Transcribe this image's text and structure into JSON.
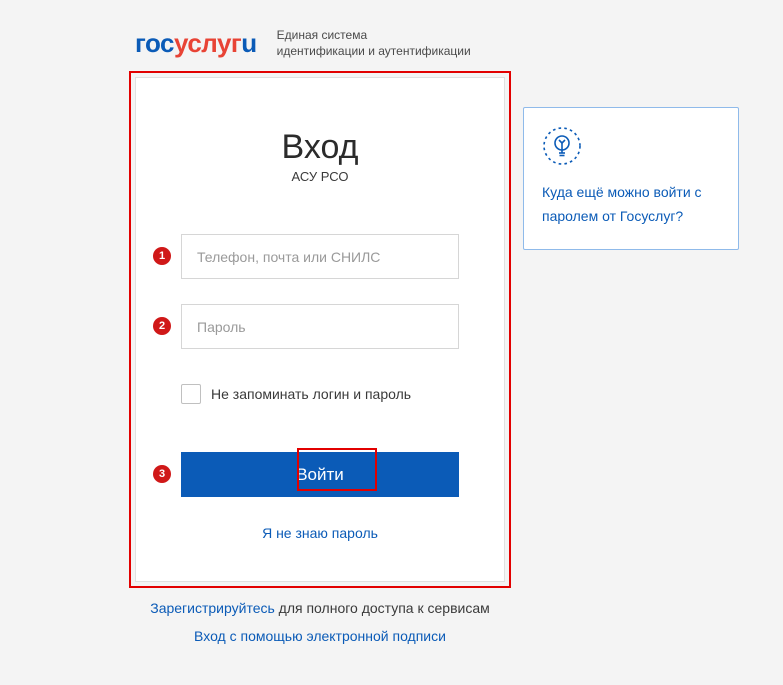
{
  "header": {
    "logo_gos": "гос",
    "logo_uslugi": "услуг",
    "logo_u": "u",
    "subtitle_line1": "Единая система",
    "subtitle_line2": "идентификации и аутентификации"
  },
  "login": {
    "title": "Вход",
    "subtitle": "АСУ РСО",
    "login_placeholder": "Телефон, почта или СНИЛС",
    "password_placeholder": "Пароль",
    "remember_label": "Не запоминать логин и пароль",
    "submit_label": "Войти",
    "forgot_label": "Я не знаю пароль"
  },
  "side": {
    "link_text": "Куда ещё можно войти с паролем от Госуслуг?"
  },
  "below": {
    "register_link": "Зарегистрируйтесь",
    "register_rest": " для полного доступа к сервисам",
    "signature_link": "Вход с помощью электронной подписи"
  },
  "annotations": {
    "b1": "1",
    "b2": "2",
    "b3": "3"
  }
}
